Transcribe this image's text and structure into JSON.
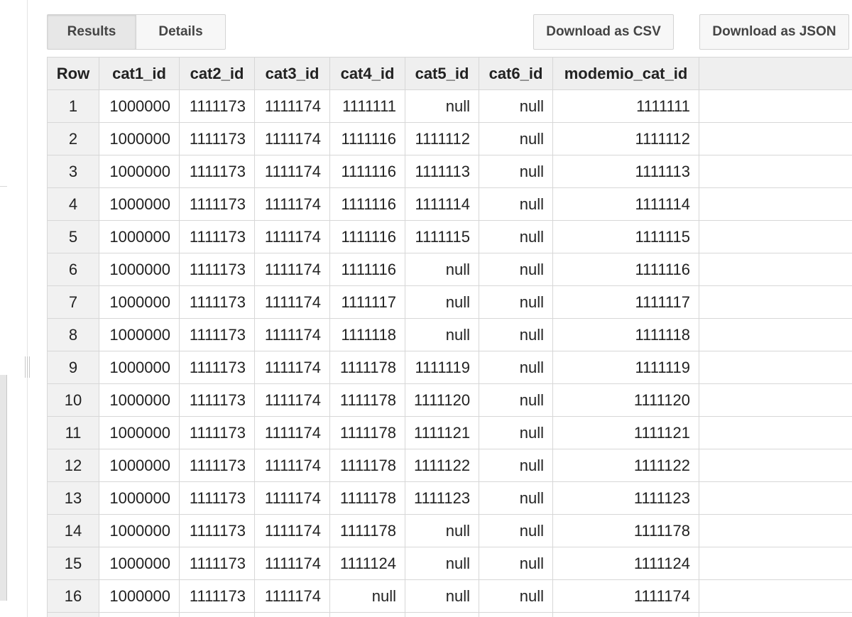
{
  "tabs": [
    {
      "label": "Results",
      "active": true
    },
    {
      "label": "Details",
      "active": false
    }
  ],
  "actions": {
    "download_csv": "Download as CSV",
    "download_json": "Download as JSON"
  },
  "table": {
    "columns": [
      "Row",
      "cat1_id",
      "cat2_id",
      "cat3_id",
      "cat4_id",
      "cat5_id",
      "cat6_id",
      "modemio_cat_id"
    ],
    "rows": [
      [
        "1",
        "1000000",
        "1111173",
        "1111174",
        "1111111",
        "null",
        "null",
        "1111111"
      ],
      [
        "2",
        "1000000",
        "1111173",
        "1111174",
        "1111116",
        "1111112",
        "null",
        "1111112"
      ],
      [
        "3",
        "1000000",
        "1111173",
        "1111174",
        "1111116",
        "1111113",
        "null",
        "1111113"
      ],
      [
        "4",
        "1000000",
        "1111173",
        "1111174",
        "1111116",
        "1111114",
        "null",
        "1111114"
      ],
      [
        "5",
        "1000000",
        "1111173",
        "1111174",
        "1111116",
        "1111115",
        "null",
        "1111115"
      ],
      [
        "6",
        "1000000",
        "1111173",
        "1111174",
        "1111116",
        "null",
        "null",
        "1111116"
      ],
      [
        "7",
        "1000000",
        "1111173",
        "1111174",
        "1111117",
        "null",
        "null",
        "1111117"
      ],
      [
        "8",
        "1000000",
        "1111173",
        "1111174",
        "1111118",
        "null",
        "null",
        "1111118"
      ],
      [
        "9",
        "1000000",
        "1111173",
        "1111174",
        "1111178",
        "1111119",
        "null",
        "1111119"
      ],
      [
        "10",
        "1000000",
        "1111173",
        "1111174",
        "1111178",
        "1111120",
        "null",
        "1111120"
      ],
      [
        "11",
        "1000000",
        "1111173",
        "1111174",
        "1111178",
        "1111121",
        "null",
        "1111121"
      ],
      [
        "12",
        "1000000",
        "1111173",
        "1111174",
        "1111178",
        "1111122",
        "null",
        "1111122"
      ],
      [
        "13",
        "1000000",
        "1111173",
        "1111174",
        "1111178",
        "1111123",
        "null",
        "1111123"
      ],
      [
        "14",
        "1000000",
        "1111173",
        "1111174",
        "1111178",
        "null",
        "null",
        "1111178"
      ],
      [
        "15",
        "1000000",
        "1111173",
        "1111174",
        "1111124",
        "null",
        "null",
        "1111124"
      ],
      [
        "16",
        "1000000",
        "1111173",
        "1111174",
        "null",
        "null",
        "null",
        "1111174"
      ],
      [
        "",
        "",
        "",
        "",
        "",
        "",
        "",
        ""
      ]
    ]
  }
}
